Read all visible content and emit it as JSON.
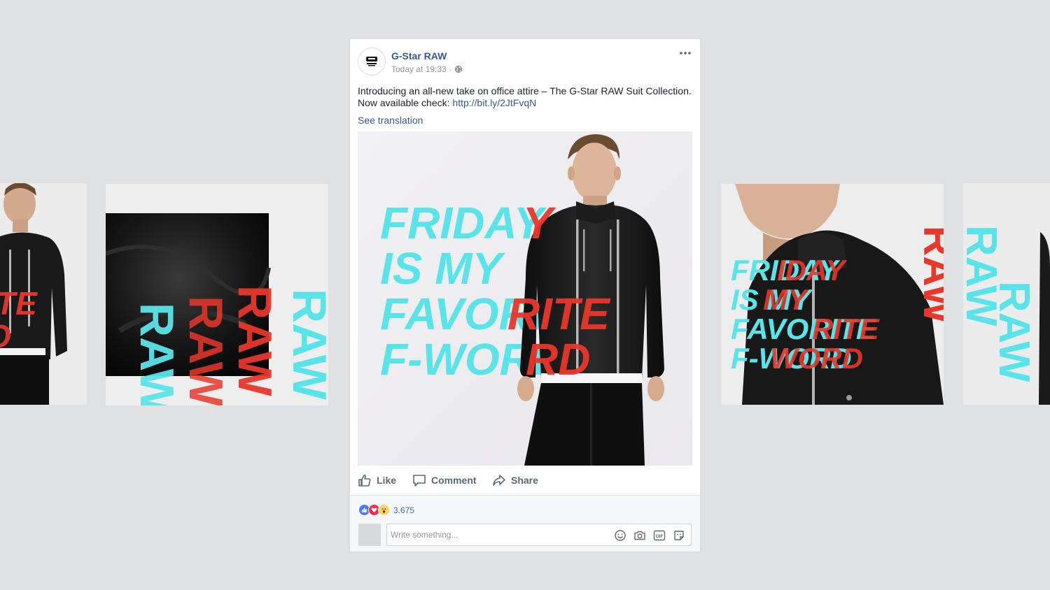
{
  "post": {
    "page_name": "G-Star RAW",
    "timestamp": "Today at 19:33 ·",
    "body_text": "Introducing an all-new take on office attire – The G-Star RAW Suit Collection. Now available check: ",
    "link_text": "http://bit.ly/2JtFvqN",
    "see_translation": "See translation",
    "image": {
      "headline_lines": [
        "FRIDAY",
        "IS MY",
        "FAVORITE",
        "F-WORD"
      ],
      "headline_color": "#5ae4ea",
      "overlay_color": "#e8372b"
    },
    "actions": {
      "like": "Like",
      "comment": "Comment",
      "share": "Share"
    },
    "reactions": {
      "types": [
        "like-icon",
        "love-icon",
        "wow-icon"
      ],
      "count": "3.675"
    },
    "comment_input": {
      "placeholder": "Write something..."
    }
  },
  "side_tiles": {
    "left_partial_text": "TE",
    "left_raw_text": "RAW",
    "right_headline_lines": [
      "FRIDAY",
      "IS MY",
      "FAVORITE",
      "F-WORD"
    ],
    "right_vertical_text": "RAW",
    "far_right_vertical_text": "RAW"
  },
  "colors": {
    "background": "#e0e1e3",
    "link": "#365899",
    "cyan": "#5ae4ea",
    "red": "#e8372b"
  }
}
